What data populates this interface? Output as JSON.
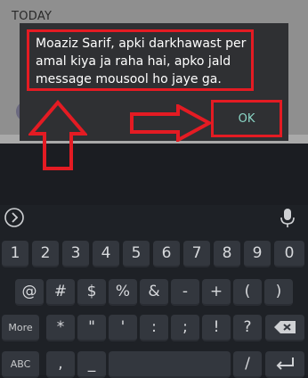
{
  "app": {
    "section_label": "TODAY"
  },
  "dialog": {
    "message": "Moaziz Sarif, apki darkhawast per amal kiya ja raha hai, apko jald message mousool ho jaye ga.",
    "ok_label": "OK"
  },
  "colors": {
    "annotation": "#e41b23",
    "ok_text": "#8ad6c6",
    "dialog_bg": "#2f3033",
    "keyboard_bg": "#1e2126"
  },
  "keyboard": {
    "suggest_icons": [
      "expand-icon",
      "microphone-icon"
    ],
    "row_numbers": [
      "1",
      "2",
      "3",
      "4",
      "5",
      "6",
      "7",
      "8",
      "9",
      "0"
    ],
    "row_symbols1": [
      "@",
      "#",
      "$",
      "%",
      "&",
      "-",
      "+",
      "(",
      ")"
    ],
    "row_symbols2": [
      "More",
      "*",
      "\"",
      "'",
      ":",
      ";",
      "!",
      "?"
    ],
    "row_bottom": [
      "ABC",
      ",",
      "_",
      "/"
    ],
    "backspace_icon": "backspace-icon",
    "enter_icon": "enter-icon"
  }
}
